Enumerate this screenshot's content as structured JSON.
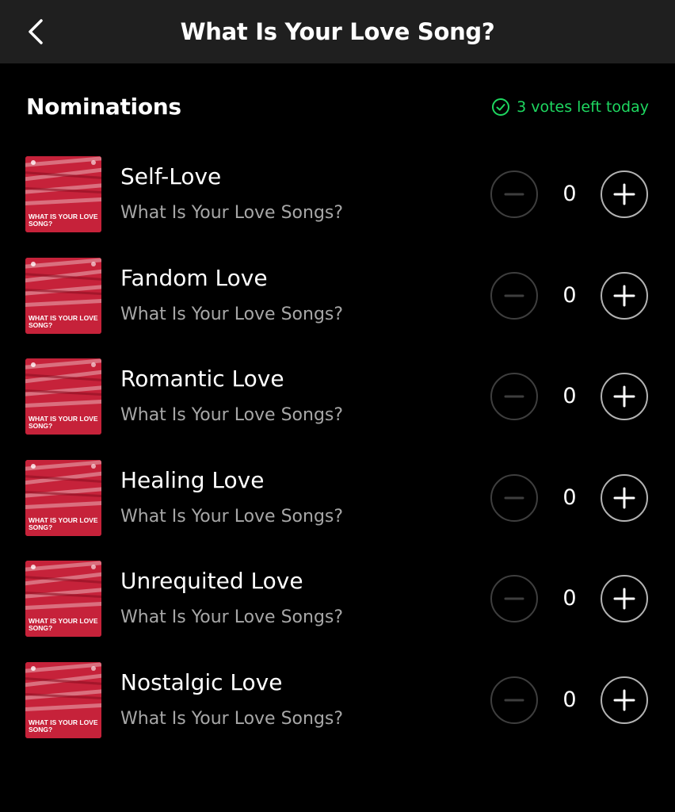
{
  "header": {
    "back_icon": "chevron-left-icon",
    "title": "What Is Your Love Song?"
  },
  "section": {
    "title": "Nominations",
    "votes_left": "3 votes left today",
    "votes_icon": "check-circle-icon",
    "accent_color": "#1ed760"
  },
  "cover_art": {
    "text": "WHAT IS YOUR LOVE SONG?",
    "color": "#c6223a"
  },
  "nominations": [
    {
      "name": "Self-Love",
      "subtitle": "What Is Your Love Songs?",
      "count": "0"
    },
    {
      "name": "Fandom Love",
      "subtitle": "What Is Your Love Songs?",
      "count": "0"
    },
    {
      "name": "Romantic Love",
      "subtitle": "What Is Your Love Songs?",
      "count": "0"
    },
    {
      "name": "Healing Love",
      "subtitle": "What Is Your Love Songs?",
      "count": "0"
    },
    {
      "name": "Unrequited Love",
      "subtitle": "What Is Your Love Songs?",
      "count": "0"
    },
    {
      "name": "Nostalgic Love",
      "subtitle": "What Is Your Love Songs?",
      "count": "0"
    }
  ]
}
